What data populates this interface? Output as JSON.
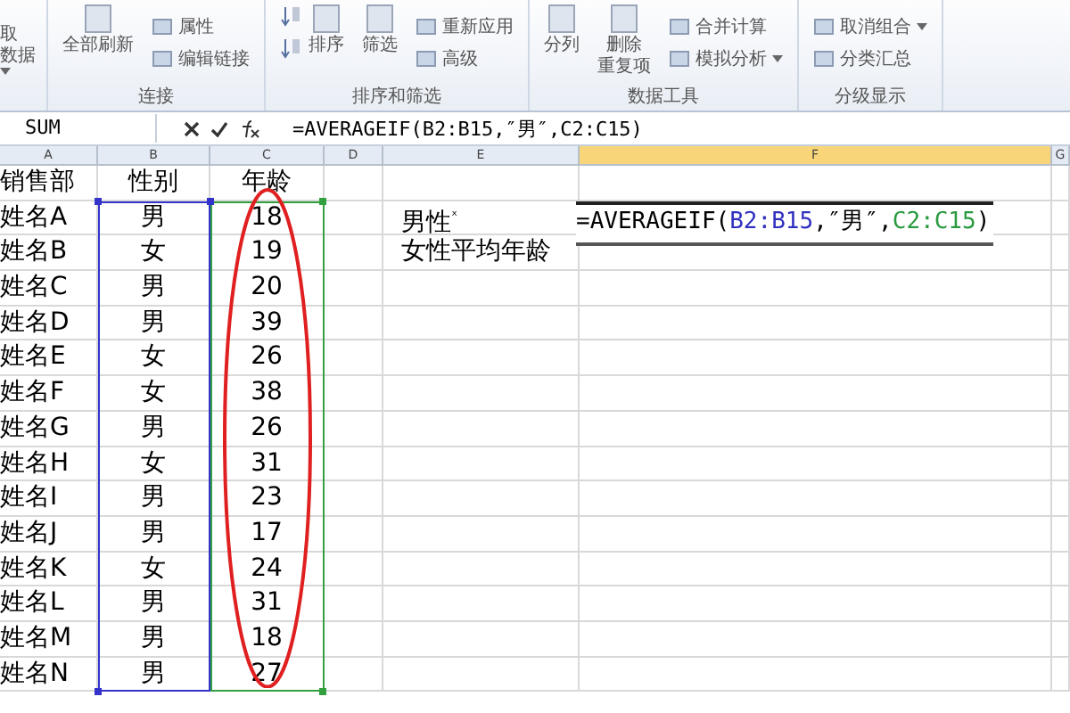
{
  "ribbon": {
    "cut_button": {
      "lines": [
        "取",
        "数据"
      ],
      "dropdown": true
    },
    "groups": [
      {
        "label": "连接",
        "items": [
          {
            "kind": "large",
            "lines": [
              "全部刷新"
            ],
            "dropdown": false
          },
          {
            "kind": "stack",
            "entries": [
              {
                "text": "属性",
                "dropdown": false
              },
              {
                "text": "编辑链接",
                "dropdown": false
              }
            ]
          }
        ]
      },
      {
        "label": "排序和筛选",
        "items": [
          {
            "kind": "sort",
            "lines": [
              "排序"
            ],
            "dropdown": false
          },
          {
            "kind": "large",
            "lines": [
              "筛选"
            ],
            "dropdown": false
          },
          {
            "kind": "stack",
            "entries": [
              {
                "text": "重新应用",
                "dropdown": false
              },
              {
                "text": "高级",
                "dropdown": false
              }
            ]
          }
        ]
      },
      {
        "label": "数据工具",
        "items": [
          {
            "kind": "large",
            "lines": [
              "分列"
            ],
            "dropdown": false
          },
          {
            "kind": "large",
            "lines": [
              "删除",
              "重复项"
            ],
            "dropdown": false
          },
          {
            "kind": "stack",
            "entries": [
              {
                "text": "合并计算",
                "dropdown": false
              },
              {
                "text": "模拟分析",
                "dropdown": true
              }
            ]
          }
        ]
      },
      {
        "label": "分级显示",
        "items": [
          {
            "kind": "stack",
            "entries": [
              {
                "text": "取消组合",
                "dropdown": true
              },
              {
                "text": "分类汇总",
                "dropdown": false
              }
            ]
          }
        ]
      }
    ]
  },
  "formula_bar": {
    "name_box": "SUM",
    "formula": "=AVERAGEIF(B2:B15,″男″,C2:C15)"
  },
  "columns": [
    {
      "label": "A",
      "selected": false
    },
    {
      "label": "B",
      "selected": false
    },
    {
      "label": "C",
      "selected": false
    },
    {
      "label": "D",
      "selected": false
    },
    {
      "label": "E",
      "selected": false
    },
    {
      "label": "F",
      "selected": true
    },
    {
      "label": "G",
      "selected": false
    }
  ],
  "header_row": [
    "销售部",
    "性别",
    "年龄"
  ],
  "rows": [
    {
      "name": "姓名A",
      "gender": "男",
      "age": "18"
    },
    {
      "name": "姓名B",
      "gender": "女",
      "age": "19"
    },
    {
      "name": "姓名C",
      "gender": "男",
      "age": "20"
    },
    {
      "name": "姓名D",
      "gender": "男",
      "age": "39"
    },
    {
      "name": "姓名E",
      "gender": "女",
      "age": "26"
    },
    {
      "name": "姓名F",
      "gender": "女",
      "age": "38"
    },
    {
      "name": "姓名G",
      "gender": "男",
      "age": "26"
    },
    {
      "name": "姓名H",
      "gender": "女",
      "age": "31"
    },
    {
      "name": "姓名I",
      "gender": "男",
      "age": "23"
    },
    {
      "name": "姓名J",
      "gender": "男",
      "age": "17"
    },
    {
      "name": "姓名K",
      "gender": "女",
      "age": "24"
    },
    {
      "name": "姓名L",
      "gender": "男",
      "age": "31"
    },
    {
      "name": "姓名M",
      "gender": "男",
      "age": "18"
    },
    {
      "name": "姓名N",
      "gender": "男",
      "age": "27"
    }
  ],
  "side_labels": [
    {
      "text": "男性",
      "mark": "ˣ"
    },
    {
      "text": "女性平均年龄"
    }
  ],
  "editing_cell": {
    "parts": [
      {
        "text": "=AVERAGEIF(",
        "color": "#000000"
      },
      {
        "text": "B2:B15",
        "color": "#3030c0"
      },
      {
        "text": ",″男″,",
        "color": "#000000"
      },
      {
        "text": "C2:C15",
        "color": "#2a9a40"
      },
      {
        "text": ")",
        "color": "#000000"
      }
    ]
  }
}
